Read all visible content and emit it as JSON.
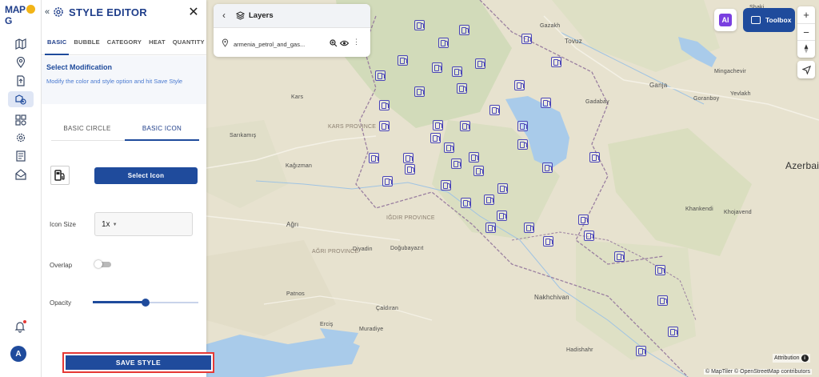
{
  "app": {
    "logo_text_left": "MAP",
    "logo_text_right": "G"
  },
  "rail": {
    "items": [
      {
        "icon": "map-icon"
      },
      {
        "icon": "location-pin-icon"
      },
      {
        "icon": "upload-file-icon"
      },
      {
        "icon": "data-analysis-icon",
        "active": true
      },
      {
        "icon": "widgets-icon"
      },
      {
        "icon": "settings-cog-icon"
      },
      {
        "icon": "report-icon"
      },
      {
        "icon": "share-icon"
      }
    ],
    "avatar_initial": "A"
  },
  "style_editor": {
    "title": "STYLE EDITOR",
    "close_glyph": "✕",
    "tabs": [
      "BASIC",
      "BUBBLE",
      "CATEGORY",
      "HEAT",
      "QUANTITY"
    ],
    "active_tab": "BASIC",
    "section_title": "Select Modification",
    "section_desc": "Modify the color and style option and hit Save Style",
    "modes": [
      "BASIC CIRCLE",
      "BASIC ICON"
    ],
    "active_mode": "BASIC ICON",
    "select_icon_label": "Select Icon",
    "icon_size_label": "Icon Size",
    "icon_size_value": "1x",
    "overlap_label": "Overlap",
    "overlap_on": false,
    "opacity_label": "Opacity",
    "opacity_value": 0.5,
    "save_label": "SAVE STYLE",
    "accent": "#1f4b9c",
    "highlight_border": "#e53935"
  },
  "layers": {
    "title": "Layers",
    "layer_name": "armenia_petrol_and_gas..."
  },
  "controls": {
    "toolbox_label": "Toolbox",
    "ai_label": "AI",
    "zoom_in": "+",
    "zoom_out": "−",
    "attribution_label": "Attribution",
    "copyright": "© MapTiler © OpenStreetMap contributors"
  },
  "map": {
    "place_labels": [
      "Gazakh",
      "Tovuz",
      "Ganja",
      "Mingachevir",
      "Goranboy",
      "Yevlakh",
      "Gadabay",
      "Kars",
      "Sarıkamış",
      "Kağızman",
      "Khankendi",
      "Khojavend",
      "Azerbai",
      "Ağrı",
      "Diyadin",
      "Doğubayazıt",
      "Patnos",
      "Çaldıran",
      "Erciş",
      "Muradiye",
      "Nakhchivan",
      "Hadishahr",
      "Shaki"
    ],
    "region_labels": [
      "KARS PROVINCE",
      "IĞDIR PROVINCE",
      "AĞRI PROVINCE"
    ],
    "pin_icon": "fuel-station-icon",
    "pin_color": "#4a45b8"
  }
}
